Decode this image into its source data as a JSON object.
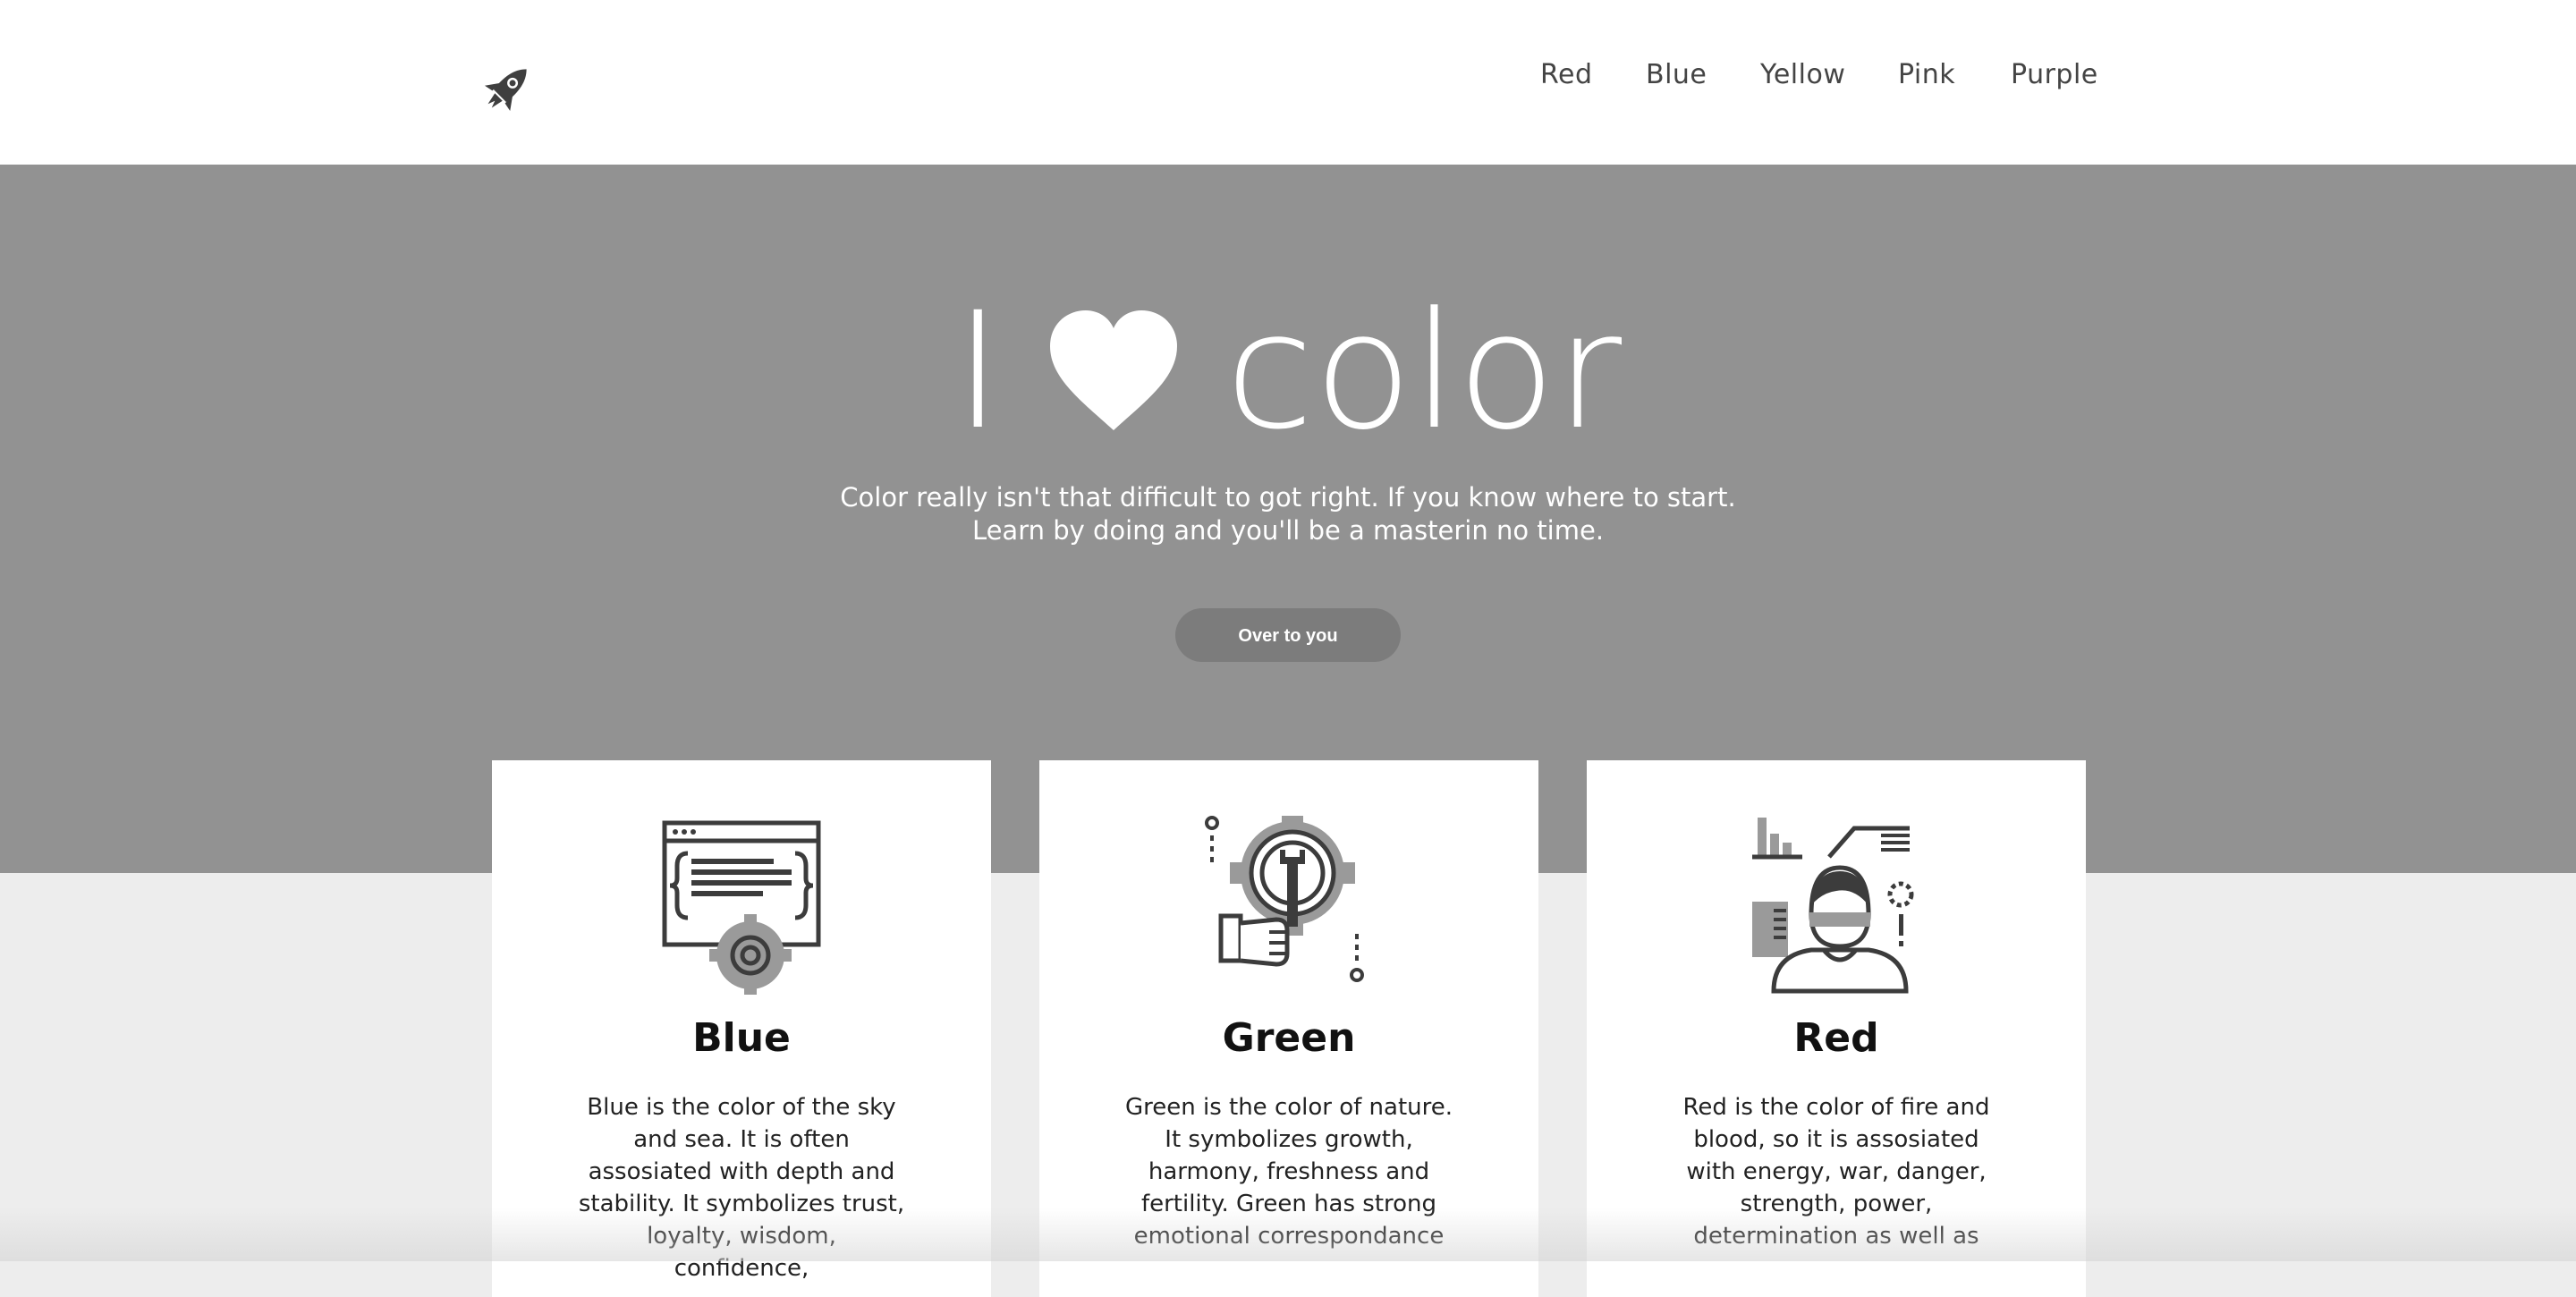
{
  "header": {
    "logo_icon": "rocket-icon",
    "nav": [
      "Red",
      "Blue",
      "Yellow",
      "Pink",
      "Purple"
    ]
  },
  "hero": {
    "title_left": "I",
    "title_icon": "heart-icon",
    "title_right": "color",
    "subtitle_line1": "Color really isn't that difficult to got right. If you know where to start.",
    "subtitle_line2": "Learn by doing and you'll be a masterin no time.",
    "button_label": "Over to you"
  },
  "cards": [
    {
      "icon": "code-settings-icon",
      "title": "Blue",
      "lines": [
        "Blue is the color of the sky",
        "and sea. It is often",
        "assosiated with depth and",
        "stability. It symbolizes trust,",
        "loyalty, wisdom, confidence,"
      ]
    },
    {
      "icon": "gear-wrench-icon",
      "title": "Green",
      "lines": [
        "Green is the color of nature.",
        "It symbolizes growth,",
        "harmony, freshness and",
        "fertility. Green has strong",
        "emotional correspondance"
      ]
    },
    {
      "icon": "analyst-icon",
      "title": "Red",
      "lines": [
        "Red is the color of fire and",
        "blood, so it is assosiated",
        "with energy, war, danger,",
        "strength, power,",
        "determination as well as"
      ]
    }
  ],
  "colors": {
    "hero_bg": "#929292",
    "button_bg": "#7c7c7c",
    "page_bg": "#ededed",
    "icon_dark": "#3c3c3c",
    "icon_mid": "#9a9a9a"
  }
}
